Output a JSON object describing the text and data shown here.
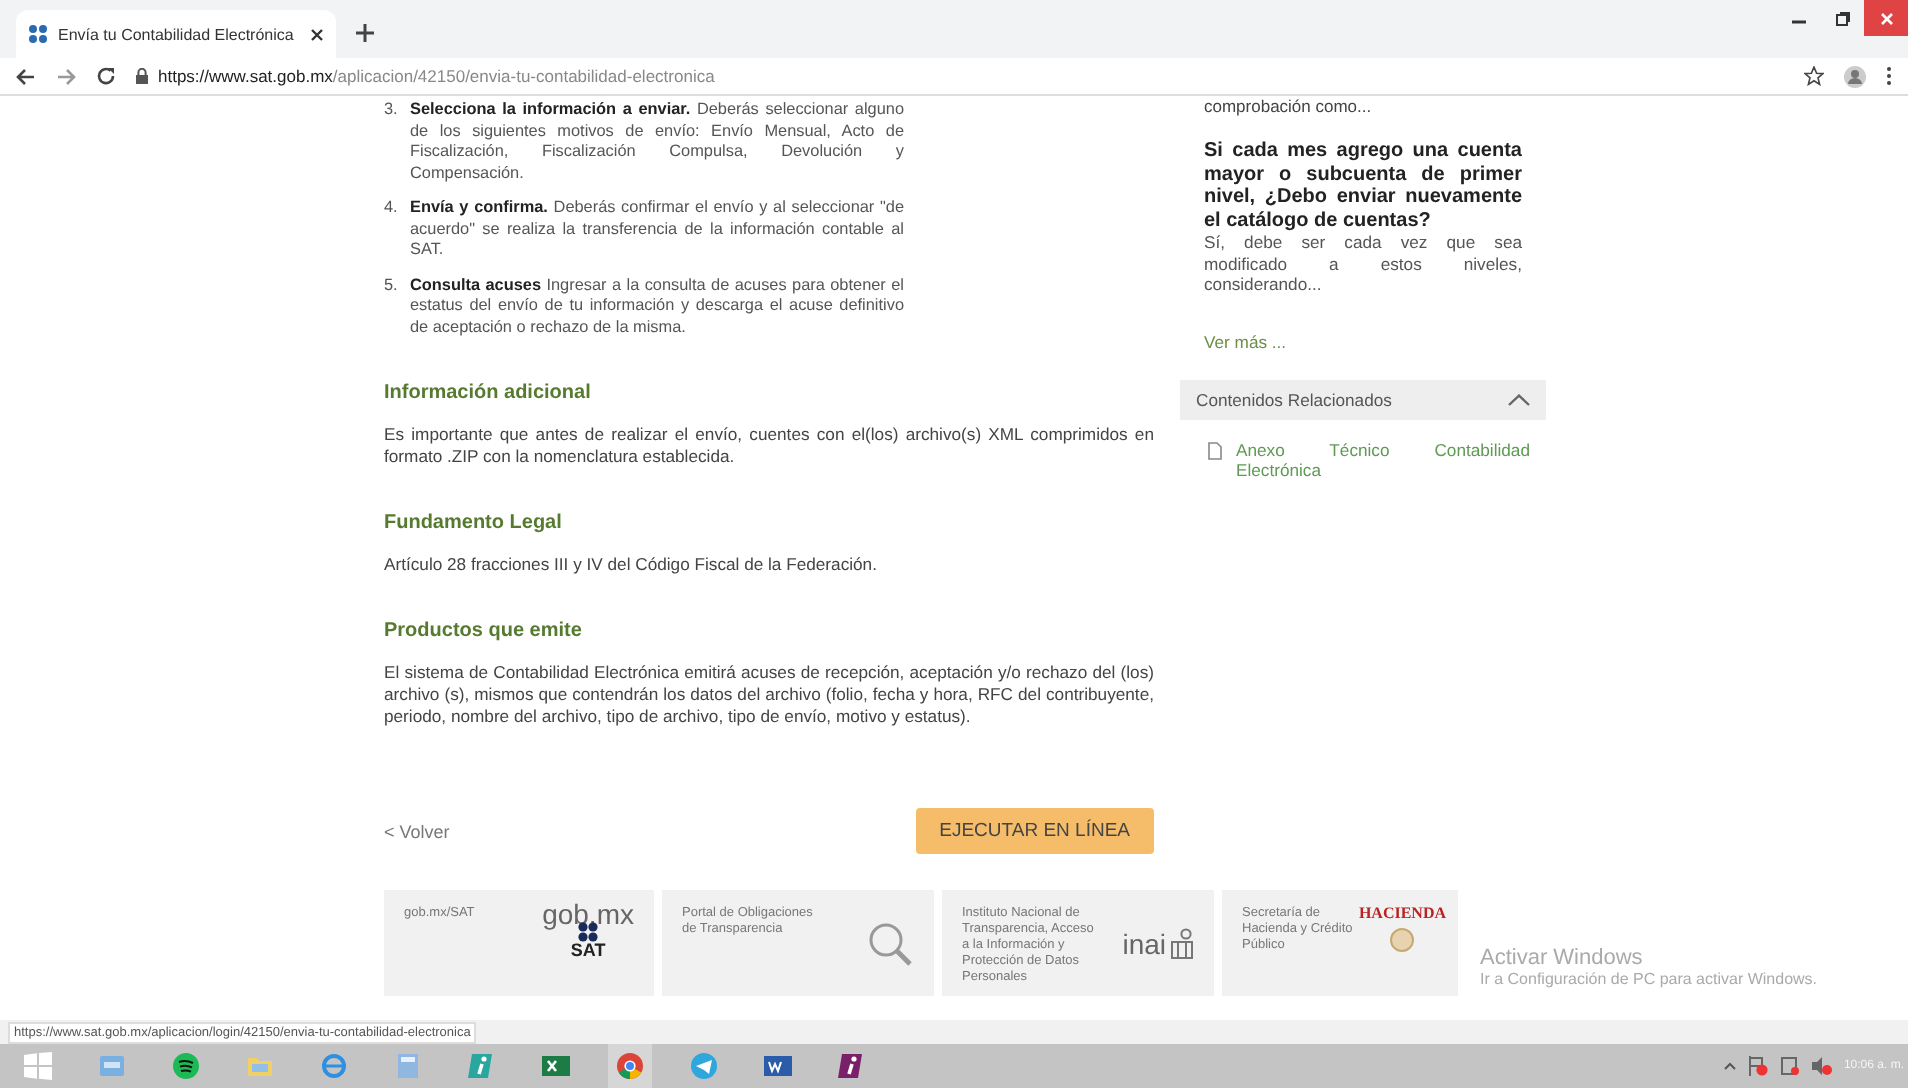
{
  "window": {
    "tab_title": "Envía tu Contabilidad Electrónica",
    "url_host": "https://www.sat.gob.mx",
    "url_path": "/aplicacion/42150/envia-tu-contabilidad-electronica"
  },
  "steps": [
    {
      "number": "3.",
      "text": "**Selecciona la información a enviar.** Deberás seleccionar alguno de los siguientes motivos de envío: Envío Mensual, Acto de Fiscalización, Fiscalización Compulsa, Devolución y Compensación."
    },
    {
      "number": "4.",
      "text": "**Envía y confirma.** Deberás confirmar el envío y al seleccionar \"de acuerdo\" se realiza la transferencia de la información contable al SAT."
    },
    {
      "number": "5.",
      "text": "**Consulta acuses** Ingresar a la consulta de acuses para obtener el estatus del envío de tu información y descarga el acuse definitivo de aceptación o rechazo de la misma."
    }
  ],
  "sections": [
    {
      "heading": "Información adicional",
      "text": "Es importante que antes de realizar el envío, cuentes con el(los) archivo(s) XML comprimidos en formato .ZIP con la nomenclatura establecida."
    },
    {
      "heading": "Fundamento Legal",
      "text": "Artículo 28 fracciones III y IV del Código Fiscal de la Federación."
    },
    {
      "heading": "Productos que emite",
      "text": "El sistema de Contabilidad Electrónica emitirá acuses de recepción, aceptación y/o rechazo del (los) archivo (s), mismos que contendrán los datos del archivo (folio, fecha y hora, RFC del contribuyente, periodo, nombre del archivo, tipo de archivo, tipo de envío, motivo y estatus)."
    }
  ],
  "back_link": "< Volver",
  "execute_button": "EJECUTAR EN LÍNEA",
  "sidebar": {
    "faq_snippet": "comprobación como...",
    "faq_question": "Si cada mes agrego una cuenta mayor o subcuenta de primer nivel, ¿Debo enviar nuevamente el catálogo de cuentas?",
    "faq_answer": "Sí, debe ser cada vez que sea modificado a estos niveles, considerando...",
    "see_more": "Ver más ...",
    "related": {
      "title": "Contenidos Relacionados",
      "expanded": true,
      "items": [
        "Anexo Técnico Contabilidad Electrónica"
      ]
    }
  },
  "footer": [
    {
      "kind": "sat",
      "label": "gob.mx/SAT",
      "logo": "gob.mx",
      "logo_sub": "SAT"
    },
    {
      "kind": "transparencia",
      "label": "Portal de Obligaciones de Transparencia"
    },
    {
      "kind": "inai",
      "label": "Instituto Nacional de Transparencia, Acceso a la Información y Protección de Datos Personales",
      "logo": "inai"
    },
    {
      "kind": "hacienda",
      "label": "Secretaría de Hacienda y Crédito Público",
      "logo": "HACIENDA"
    }
  ],
  "activation": {
    "title": "Activar Windows",
    "text": "Ir a Configuración de PC para activar Windows."
  },
  "status_url": "https://www.sat.gob.mx/aplicacion/login/42150/envia-tu-contabilidad-electronica",
  "taskbar": {
    "apps": [
      {
        "kind": "start"
      },
      {
        "kind": "explorer"
      },
      {
        "kind": "spotify"
      },
      {
        "kind": "folder"
      },
      {
        "kind": "ie"
      },
      {
        "kind": "calc"
      },
      {
        "kind": "ipurple"
      },
      {
        "kind": "excel"
      },
      {
        "kind": "chrome",
        "selected": true
      },
      {
        "kind": "telegram"
      },
      {
        "kind": "word"
      },
      {
        "kind": "ipurple2"
      }
    ],
    "time": "10:06 a. m."
  }
}
